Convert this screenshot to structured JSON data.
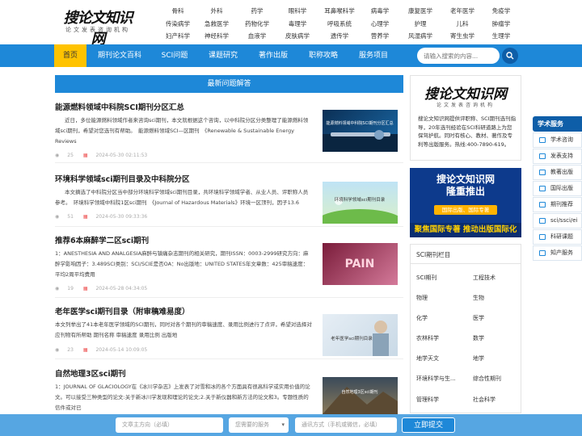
{
  "logo": {
    "title": "搜论文知识网",
    "subtitle": "论文发表咨询机构"
  },
  "categories": [
    [
      "骨科",
      "外科",
      "药学",
      "眼科学",
      "耳鼻喉科学",
      "病毒学",
      "康复医学",
      "老年医学",
      "免疫学"
    ],
    [
      "传染病学",
      "急救医学",
      "药物化学",
      "毒理学",
      "呼吸系统",
      "心理学",
      "护理",
      "儿科",
      "肿瘤学"
    ],
    [
      "妇产科学",
      "神经科学",
      "血液学",
      "皮肤病学",
      "遗传学",
      "营养学",
      "风湿病学",
      "寄生虫学",
      "生理学"
    ]
  ],
  "nav": {
    "items": [
      "首页",
      "期刊论文百科",
      "SCI问题",
      "课题研究",
      "著作出版",
      "职称攻略",
      "服务项目"
    ],
    "search_placeholder": "请输入搜索的内容..."
  },
  "main": {
    "title": "最新问题解答",
    "articles": [
      {
        "title": "能源燃料领域中科院SCI期刊分区汇总",
        "desc": "近日，多位能源燃料领域作者来咨询sci期刊，本文就根据这个咨询，以中科院分区分类整理了能源燃料领域sci期刊，希望对您选刊有帮助。　能源燃料领域SCI—区期刊　《Renewable & Sustainable Energy Reviews",
        "views": "25",
        "date": "2024-05-30 02:11:53",
        "img_text": "能源燃料领域中科院SCI期刊分区汇总"
      },
      {
        "title": "环境科学领域sci期刊目录及中科院分区",
        "desc": "本文摘选了中科院分区当中部分环境科学领域sci期刊目录，共环境科学领域学者、从业人员、评职称人员参考。　环境科学领域中科院1区sci期刊　《Journal of Hazardous Materials》环境一区顶刊，因子13.6",
        "views": "51",
        "date": "2024-05-30 09:33:36",
        "img_text": "环境科学领域sci期刊目录"
      },
      {
        "title": "推荐6本麻醉学二区sci期刊",
        "desc": "1：ANESTHESIA AND ANALGESIA麻醉与镇痛杂志期刊的相关研究，期刊ISSN：0003-2999研究方向：麻醉学影响因子：3.489SCI类别：SCI/SCIE是否OA：No出版地：UNITED STATES年文章数：425审稿速度：平均2周平均费用",
        "views": "19",
        "date": "2024-05-28 04:34:05",
        "img_text": "PAIN"
      },
      {
        "title": "老年医学sci期刊目录（附审稿难易度）",
        "desc": "本文列举出了41本老年医学领域的SCI期刊，同时对各个期刊的审稿速度、录用比例进行了点评，希望对选择对应刊物有所帮助 期刊名称 审稿速度 录用比例 出版地",
        "views": "23",
        "date": "2024-05-14 10:09:05",
        "img_text": "老年医学sci期刊目录"
      },
      {
        "title": "自然地理3区sci期刊",
        "desc": "1：JOURNAL OF GLACIOLOGY在《冰川学杂志》上发表了对雪和冰的各个方面具有很高科学或实用价值的论文。可以接受三种类型的论文:关于新冰川学发现和理论的论文;2.关于新仪器和新方法的论文和3。专题性质的信件或对已",
        "views": "",
        "date": "",
        "img_text": "自然地理3区sci期刊"
      }
    ]
  },
  "sidebar": {
    "intro": {
      "title": "搜论文知识网",
      "subtitle": "论文发表咨询机构",
      "text": "搜论文知识网提供评职称、SCI期刊选刊指导，20年选刊经验在SCI科研道路上为您保驾护航。同时有核心、教材、著作及专利等出版服务。热线:400-7890-619。"
    },
    "banner": {
      "line1": "搜论文知识网",
      "line2": "隆重推出",
      "badge": "国际出版、国际专著",
      "bottom": "聚焦国际专著 推动出版国际化"
    },
    "sci_list": {
      "title": "SCI期刊栏目",
      "items": [
        "SCI期刊",
        "工程技术",
        "物理",
        "生物",
        "化学",
        "医学",
        "农林科学",
        "数学",
        "地学天文",
        "地学",
        "环境科学与生...",
        "综合性期刊",
        "管理科学",
        "社会科学"
      ]
    }
  },
  "float_menu": {
    "head": "学术服务",
    "items": [
      "学术咨询",
      "发表支持",
      "教著出版",
      "国际出版",
      "期刊推荐",
      "sci/ssci/ei",
      "科研课题",
      "知产服务"
    ]
  },
  "bottom_bar": {
    "field1_placeholder": "文章主方向（必填）",
    "field2_placeholder": "您需要的服务",
    "field3_placeholder": "通讯方式（手机或微信，必填）",
    "submit": "立即提交"
  },
  "colors": {
    "primary": "#1e88d8",
    "accent": "#ffc300",
    "dark": "#0e5ea8"
  }
}
